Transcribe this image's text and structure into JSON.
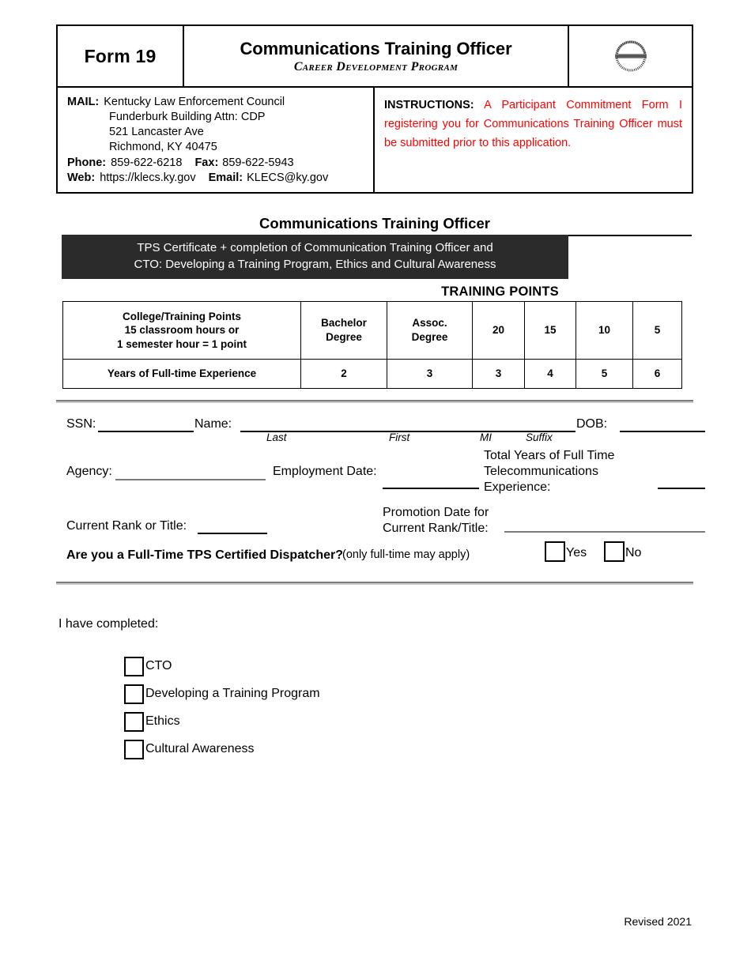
{
  "header": {
    "form_number": "Form 19",
    "title": "Communications Training Officer",
    "subtitle": "Career Development Program",
    "logo": {
      "name": "career-development-program-seal",
      "outer_text": "CAREER DEVELOPMENT PROGRAM",
      "lower_text": "KENTUCKY LAW ENFORCEMENT COUNCIL",
      "band_text": "TRAINING · EDUCATION · EXPERIENCE",
      "colors": {
        "gold": "#f0b323",
        "orange": "#e8742c",
        "navy": "#1c2f6e",
        "blue": "#2f6fb5"
      }
    },
    "mail": {
      "label": "MAIL:",
      "line1": "Kentucky Law Enforcement Council",
      "line2": "Funderburk Building  Attn:  CDP",
      "line3": "521 Lancaster Ave",
      "line4": "Richmond, KY  40475",
      "phone_label": "Phone:",
      "phone_value": "859-622-6218",
      "fax_label": "Fax:",
      "fax_value": "859-622-5943",
      "web_label": "Web:",
      "web_value": "https://klecs.ky.gov",
      "email_label": "Email:",
      "email_value": "KLECS@ky.gov"
    },
    "instructions": {
      "label": "INSTRUCTIONS:",
      "text": "A Participant Commitment Form I registering you for Communications Training Officer must be submitted prior to this application.",
      "text_color": "#ff0000"
    }
  },
  "section": {
    "title": "Communications Training Officer",
    "banner_text": "TPS Certificate + completion of Communication Training Officer and\nCTO: Developing a Training Program, Ethics and Cultural Awareness",
    "banner_bg": "#2b2b2b"
  },
  "training_points": {
    "heading": "TRAINING POINTS",
    "rows": [
      {
        "label": "College/Training Points\n15 classroom hours or\n1 semester hour = 1 point",
        "cells": [
          "Bachelor\nDegree",
          "Assoc.\nDegree",
          "20",
          "15",
          "10",
          "5"
        ]
      },
      {
        "label": "Years of Full-time Experience",
        "cells": [
          "2",
          "3",
          "3",
          "4",
          "5",
          "6"
        ]
      }
    ]
  },
  "applicant": {
    "ssn_label": "SSN:",
    "name_label": "Name:",
    "dob_label": "DOB:",
    "name_parts": {
      "last": "Last",
      "first": "First",
      "mi": "MI",
      "suffix": "Suffix"
    },
    "agency_label": "Agency:",
    "employment_date_label": "Employment Date:",
    "total_years_label": "Total Years of Full Time\nTelecommunications\nExperience:",
    "current_rank_label": "Current Rank or Title:",
    "promotion_date_label": "Promotion Date for\nCurrent Rank/Title:",
    "dispatcher_question": "Are you a Full-Time TPS Certified Dispatcher?",
    "dispatcher_note": "(only full-time may apply)",
    "yes_label": "Yes",
    "no_label": "No",
    "values": {
      "ssn": "",
      "name": "",
      "dob": "",
      "agency": "",
      "employment_date": "",
      "total_years": "",
      "current_rank": "",
      "promotion_date": ""
    }
  },
  "completed": {
    "heading": "I have completed:",
    "items": [
      {
        "label": "CTO",
        "checked": false
      },
      {
        "label": "Developing a Training Program",
        "checked": false
      },
      {
        "label": "Ethics",
        "checked": false
      },
      {
        "label": "Cultural Awareness",
        "checked": false
      }
    ]
  },
  "footer": {
    "revision": "Revised 2021"
  }
}
